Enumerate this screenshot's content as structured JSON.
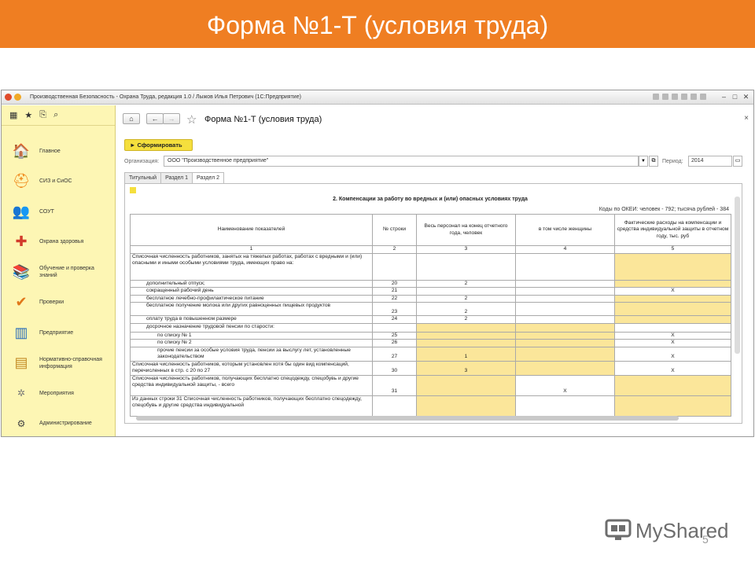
{
  "slide": {
    "title": "Форма №1-Т (условия труда)",
    "page_number": "5",
    "logo_text": "MyShared"
  },
  "window": {
    "title": "Производственная Безопасность - Охрана Труда, редакция 1.0 / Лыжов Илья Петрович (1С:Предприятие)"
  },
  "sidebar": {
    "items": [
      {
        "label": "Главное",
        "icon": "home-desk-icon"
      },
      {
        "label": "СИЗ и СиОС",
        "icon": "hard-hat-icon"
      },
      {
        "label": "СОУТ",
        "icon": "people-icon"
      },
      {
        "label": "Охрана здоровья",
        "icon": "first-aid-icon"
      },
      {
        "label": "Обучение и проверка знаний",
        "icon": "books-icon"
      },
      {
        "label": "Проверки",
        "icon": "checkmark-icon"
      },
      {
        "label": "Предприятие",
        "icon": "building-icon"
      },
      {
        "label": "Нормативно-справочная информация",
        "icon": "binders-icon"
      },
      {
        "label": "Мероприятия",
        "icon": "events-icon"
      },
      {
        "label": "Администрирование",
        "icon": "gear-icon"
      }
    ]
  },
  "form": {
    "title": "Форма №1-Т (условия труда)",
    "generate_label": "► Сформировать",
    "org_label": "Организация:",
    "org_value": "ООО \"Производственное предприятие\"",
    "period_label": "Период:",
    "period_value": "2014",
    "tabs": [
      "Титульный",
      "Раздел 1",
      "Раздел 2"
    ],
    "active_tab": 2
  },
  "report": {
    "title": "2. Компенсации за работу во вредных и (или) опасных условиях труда",
    "codes": "Коды по ОКЕИ: человек - 792; тысяча рублей - 384",
    "headers": [
      "Наименование показателей",
      "№ строки",
      "Весь персонал на конец отчетного года, человек",
      "в том числе женщины",
      "Фактические расходы на компенсации и средства индивидуальной защиты в отчетном году, тыс. руб"
    ],
    "header_numbers": [
      "1",
      "2",
      "3",
      "4",
      "5"
    ],
    "rows": [
      {
        "name": "Списочная численность работников, занятых на тяжелых работах, работах с вредными и (или) опасными и иными особыми условиями труда, имеющих право на:",
        "indent": 0,
        "line": "",
        "c3": "",
        "c4": "",
        "c5": "",
        "y3": false,
        "y4": false,
        "y5": true
      },
      {
        "name": "дополнительный отпуск;",
        "indent": 1,
        "line": "20",
        "c3": "2",
        "c4": "",
        "c5": "",
        "y3": false,
        "y4": false,
        "y5": true
      },
      {
        "name": "сокращенный рабочий день",
        "indent": 1,
        "line": "21",
        "c3": "",
        "c4": "",
        "c5": "X",
        "y3": false,
        "y4": false,
        "y5": false
      },
      {
        "name": "бесплатное лечебно-профилактическое питание",
        "indent": 1,
        "line": "22",
        "c3": "2",
        "c4": "",
        "c5": "",
        "y3": false,
        "y4": false,
        "y5": true
      },
      {
        "name": "бесплатное получение молока или других равноценных пищевых продуктов",
        "indent": 1,
        "line": "23",
        "c3": "2",
        "c4": "",
        "c5": "",
        "y3": false,
        "y4": false,
        "y5": true
      },
      {
        "name": "оплату труда в повышенном размере",
        "indent": 1,
        "line": "24",
        "c3": "2",
        "c4": "",
        "c5": "",
        "y3": false,
        "y4": false,
        "y5": true
      },
      {
        "name": "досрочное назначение трудовой пенсии по старости:",
        "indent": 1,
        "line": "",
        "c3": "",
        "c4": "",
        "c5": "",
        "y3": true,
        "y4": true,
        "y5": false
      },
      {
        "name": "по списку № 1",
        "indent": 2,
        "line": "25",
        "c3": "",
        "c4": "",
        "c5": "X",
        "y3": true,
        "y4": true,
        "y5": false
      },
      {
        "name": "по списку № 2",
        "indent": 2,
        "line": "26",
        "c3": "",
        "c4": "",
        "c5": "X",
        "y3": true,
        "y4": true,
        "y5": false
      },
      {
        "name": "прочие пенсии за особые условия труда, пенсии за выслугу лет, установленные законодательством",
        "indent": 2,
        "line": "27",
        "c3": "1",
        "c4": "",
        "c5": "X",
        "y3": true,
        "y4": true,
        "y5": false
      },
      {
        "name": "Списочная численность работников, которым установлен хотя бы один вид компенсаций, перечисленных в стр. с 20 по 27",
        "indent": 0,
        "line": "30",
        "c3": "3",
        "c4": "",
        "c5": "X",
        "y3": true,
        "y4": true,
        "y5": false
      },
      {
        "name": "Списочная численность работников, получающих бесплатно спецодежду, спецобувь и другие средства индивидуальной защиты, - всего",
        "indent": 0,
        "line": "31",
        "c3": "",
        "c4": "X",
        "c5": "",
        "y3": true,
        "y4": false,
        "y5": true
      },
      {
        "name": "Из данных строки 31 Списочная численность работников, получающих бесплатно спецодежду, спецобувь и другие средства индивидуальной",
        "indent": 0,
        "line": "",
        "c3": "",
        "c4": "",
        "c5": "",
        "y3": true,
        "y4": false,
        "y5": true
      }
    ]
  }
}
